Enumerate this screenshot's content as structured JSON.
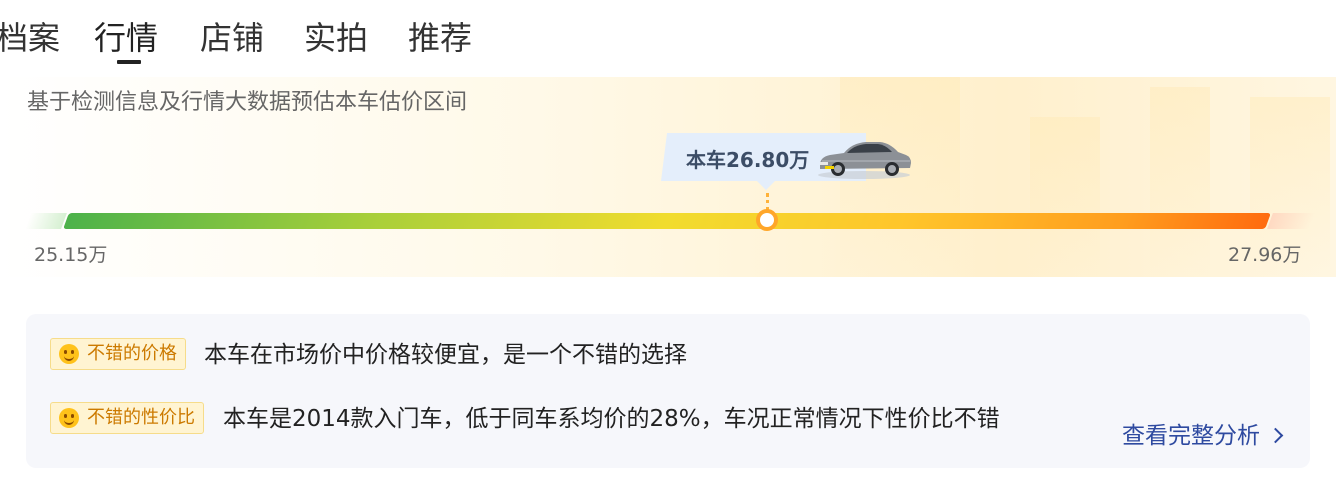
{
  "tabs": [
    {
      "label": "档案",
      "active": false
    },
    {
      "label": "行情",
      "active": true
    },
    {
      "label": "店铺",
      "active": false
    },
    {
      "label": "实拍",
      "active": false
    },
    {
      "label": "推荐",
      "active": false
    }
  ],
  "market": {
    "subtitle": "基于检测信息及行情大数据预估本车估价区间",
    "current_label": "本车26.80万",
    "range_min": "25.15万",
    "range_max": "27.96万",
    "current_value": 26.8,
    "min_value": 25.15,
    "max_value": 27.96
  },
  "analysis": {
    "items": [
      {
        "badge": "不错的价格",
        "icon": "smile-icon",
        "text": "本车在市场价中价格较便宜，是一个不错的选择"
      },
      {
        "badge": "不错的性价比",
        "icon": "smile-icon",
        "text": "本车是2014款入门车，低于同车系均价的28%，车况正常情况下性价比不错"
      }
    ],
    "link_label": "查看完整分析"
  },
  "colors": {
    "badge_bg": "#fff4d2",
    "badge_text": "#cc7a00",
    "link": "#2e4aa0",
    "range_start": "#4cb24a",
    "range_end": "#ff6b0f"
  }
}
